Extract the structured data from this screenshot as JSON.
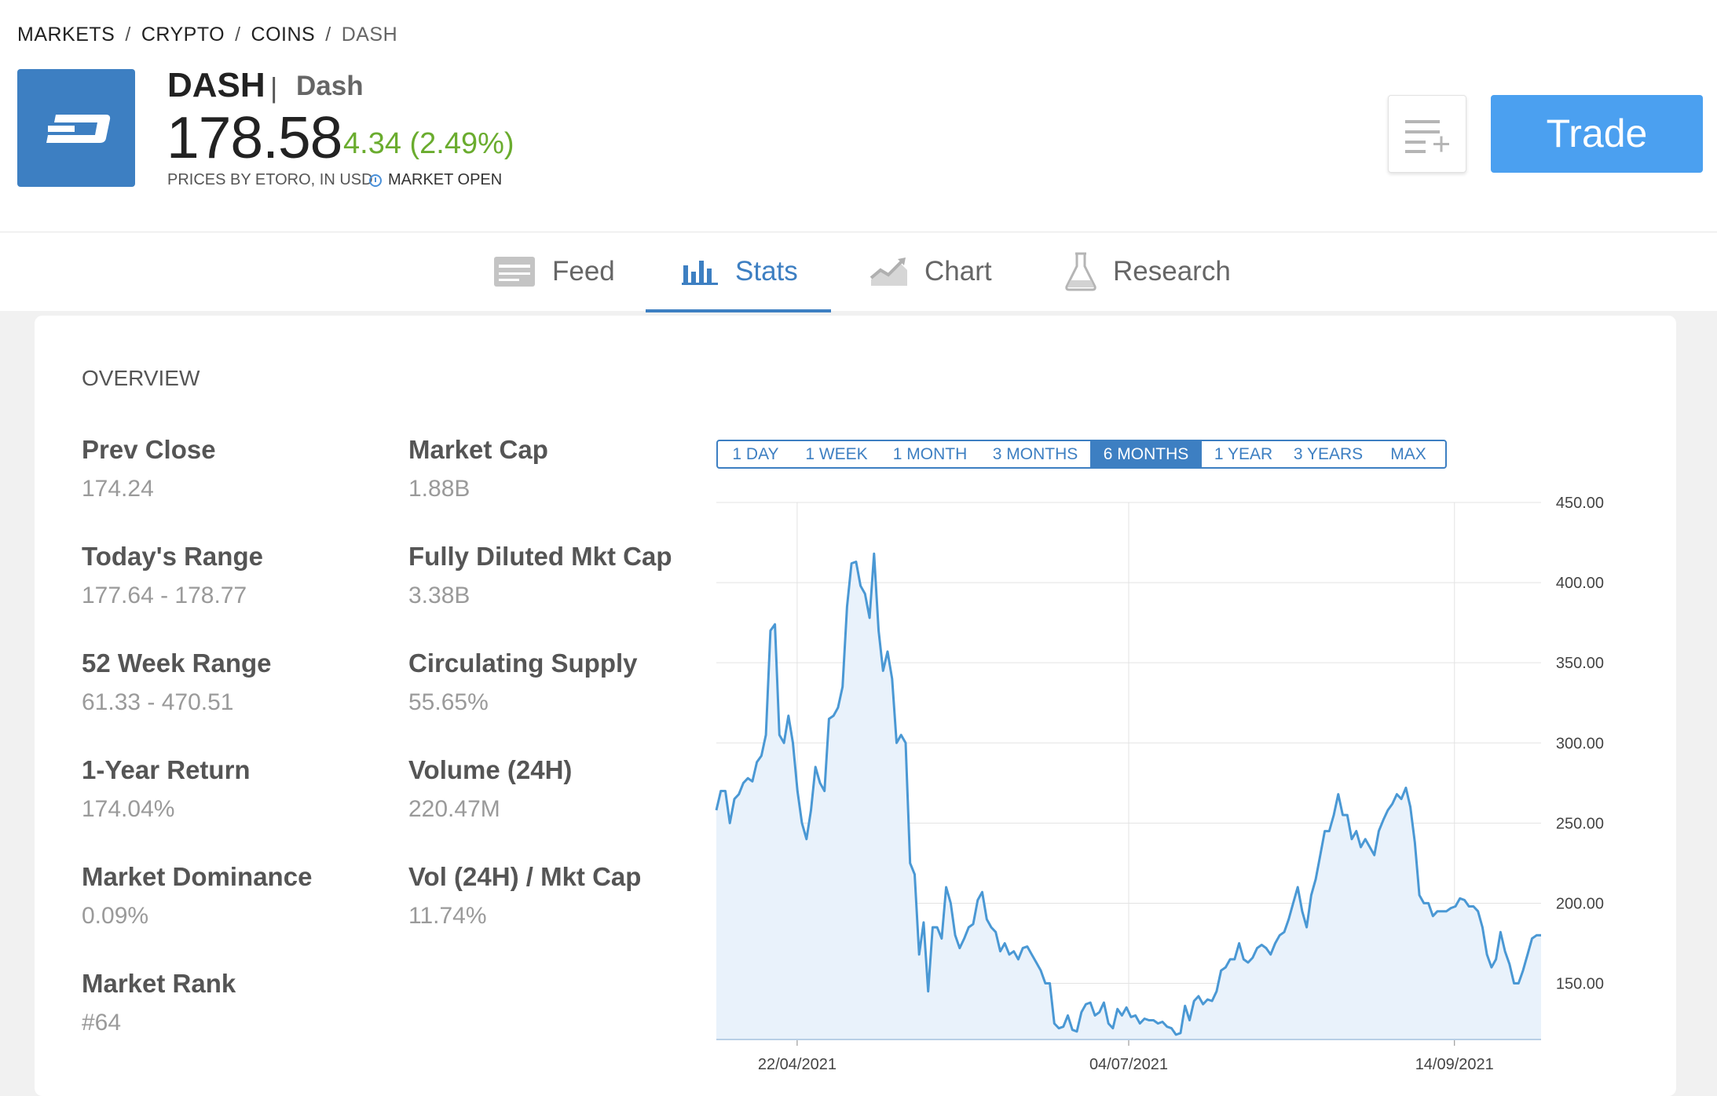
{
  "breadcrumb": {
    "items": [
      "MARKETS",
      "CRYPTO",
      "COINS"
    ],
    "current": "DASH",
    "separator": "/"
  },
  "instrument": {
    "ticker": "DASH",
    "separator": "|",
    "name": "Dash",
    "price": "178.58",
    "change": "4.34 (2.49%)",
    "prices_by": "PRICES BY ETORO, IN USD",
    "market_status": "MARKET OPEN",
    "logo_icon": "dash-logo-icon"
  },
  "actions": {
    "watchlist_icon": "add-to-watchlist-icon",
    "trade_label": "Trade"
  },
  "tabs": [
    {
      "label": "Feed",
      "icon": "feed-icon",
      "active": false
    },
    {
      "label": "Stats",
      "icon": "bar-chart-icon",
      "active": true
    },
    {
      "label": "Chart",
      "icon": "trend-chart-icon",
      "active": false
    },
    {
      "label": "Research",
      "icon": "flask-icon",
      "active": false
    }
  ],
  "overview": {
    "title": "OVERVIEW",
    "stats": [
      {
        "label": "Prev Close",
        "value": "174.24"
      },
      {
        "label": "Market Cap",
        "value": "1.88B"
      },
      {
        "label": "Today's Range",
        "value": "177.64 - 178.77"
      },
      {
        "label": "Fully Diluted Mkt Cap",
        "value": "3.38B"
      },
      {
        "label": "52 Week Range",
        "value": "61.33 - 470.51"
      },
      {
        "label": "Circulating Supply",
        "value": "55.65%"
      },
      {
        "label": "1-Year Return",
        "value": "174.04%"
      },
      {
        "label": "Volume (24H)",
        "value": "220.47M"
      },
      {
        "label": "Market Dominance",
        "value": "0.09%"
      },
      {
        "label": "Vol (24H) / Mkt Cap",
        "value": "11.74%"
      },
      {
        "label": "Market Rank",
        "value": "#64"
      }
    ]
  },
  "range_selector": {
    "options": [
      "1 DAY",
      "1 WEEK",
      "1 MONTH",
      "3 MONTHS",
      "6 MONTHS",
      "1 YEAR",
      "3 YEARS",
      "MAX"
    ],
    "selected": "6 MONTHS"
  },
  "colors": {
    "accent": "#3d7fc2",
    "trade": "#4ba0f0",
    "positive": "#6aac2e",
    "line": "#4a98d4",
    "area": "#e9f2fb"
  },
  "chart_data": {
    "type": "area",
    "x_ticks": [
      "22/04/2021",
      "04/07/2021",
      "14/09/2021"
    ],
    "y_ticks": [
      150,
      200,
      250,
      300,
      350,
      400,
      450
    ],
    "ylim": [
      115,
      450
    ],
    "grid": true,
    "y_axis_position": "right",
    "values": [
      258,
      270,
      270,
      250,
      265,
      268,
      275,
      278,
      276,
      288,
      292,
      305,
      370,
      374,
      305,
      300,
      317,
      300,
      270,
      250,
      240,
      258,
      285,
      275,
      270,
      315,
      317,
      322,
      335,
      385,
      412,
      413,
      398,
      393,
      378,
      418,
      370,
      345,
      357,
      340,
      300,
      305,
      300,
      225,
      218,
      168,
      188,
      145,
      185,
      185,
      178,
      210,
      200,
      180,
      172,
      178,
      185,
      187,
      202,
      207,
      190,
      185,
      182,
      170,
      175,
      168,
      170,
      165,
      172,
      173,
      168,
      163,
      158,
      150,
      150,
      125,
      122,
      123,
      130,
      121,
      120,
      132,
      137,
      138,
      130,
      132,
      138,
      125,
      122,
      134,
      130,
      135,
      129,
      130,
      125,
      128,
      127,
      127,
      125,
      126,
      123,
      122,
      118,
      119,
      136,
      127,
      139,
      142,
      137,
      140,
      139,
      145,
      158,
      160,
      165,
      165,
      175,
      165,
      163,
      166,
      172,
      174,
      172,
      168,
      175,
      180,
      182,
      190,
      200,
      210,
      195,
      185,
      205,
      215,
      230,
      245,
      245,
      255,
      268,
      255,
      255,
      240,
      245,
      235,
      240,
      235,
      230,
      245,
      252,
      258,
      262,
      268,
      265,
      272,
      260,
      238,
      205,
      200,
      200,
      192,
      195,
      195,
      195,
      197,
      198,
      203,
      202,
      198,
      198,
      195,
      185,
      168,
      160,
      165,
      182,
      170,
      162,
      150,
      150,
      158,
      168,
      178,
      180,
      180
    ]
  }
}
